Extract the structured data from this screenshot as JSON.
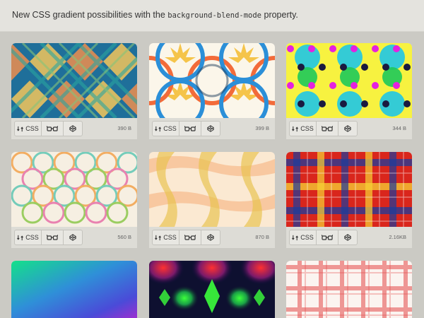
{
  "header": {
    "text_before": "New CSS gradient possibilities with the ",
    "code": "background-blend-mode",
    "text_after": " property."
  },
  "card_button_label": "CSS",
  "cards": [
    {
      "size": "390 B",
      "pattern": "argyle"
    },
    {
      "size": "399 B",
      "pattern": "rings"
    },
    {
      "size": "344 B",
      "pattern": "polka"
    },
    {
      "size": "560 B",
      "pattern": "floral-rings"
    },
    {
      "size": "870 B",
      "pattern": "wavy-plaid"
    },
    {
      "size": "2.16KB",
      "pattern": "tartan"
    },
    {
      "size": "",
      "pattern": "rainbow-gradient"
    },
    {
      "size": "",
      "pattern": "radial-glow"
    },
    {
      "size": "",
      "pattern": "red-gingham"
    }
  ],
  "icons": {
    "css": "swap-arrows-icon",
    "view": "glasses-icon",
    "pen": "codepen-cube-icon"
  }
}
